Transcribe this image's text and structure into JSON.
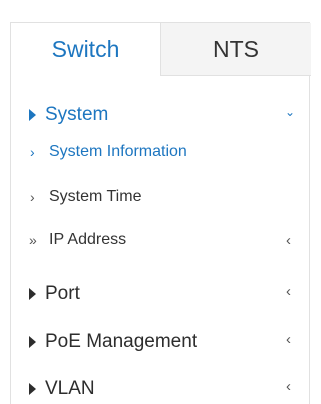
{
  "tabs": [
    {
      "label": "Switch",
      "active": true
    },
    {
      "label": "NTS",
      "active": false
    }
  ],
  "menu": {
    "system": {
      "label": "System",
      "expanded": true
    },
    "system_children": [
      {
        "label": "System Information",
        "active": true
      },
      {
        "label": "System Time",
        "active": false
      },
      {
        "label": "IP Address",
        "active": false
      }
    ],
    "items": [
      {
        "label": "Port"
      },
      {
        "label": "PoE Management"
      },
      {
        "label": "VLAN"
      }
    ]
  },
  "icons": {
    "expand": "triangle-right-icon",
    "collapse_caret": "chevron-left-icon",
    "expanded_caret": "chevron-down-icon",
    "sub_item": "chevron-right-icon",
    "sub_group": "double-chevron-right-icon"
  },
  "colors": {
    "accent": "#1d76c0",
    "text": "#2d2d2d",
    "tab_inactive_bg": "#f4f4f4",
    "border": "#e1e1e1"
  }
}
